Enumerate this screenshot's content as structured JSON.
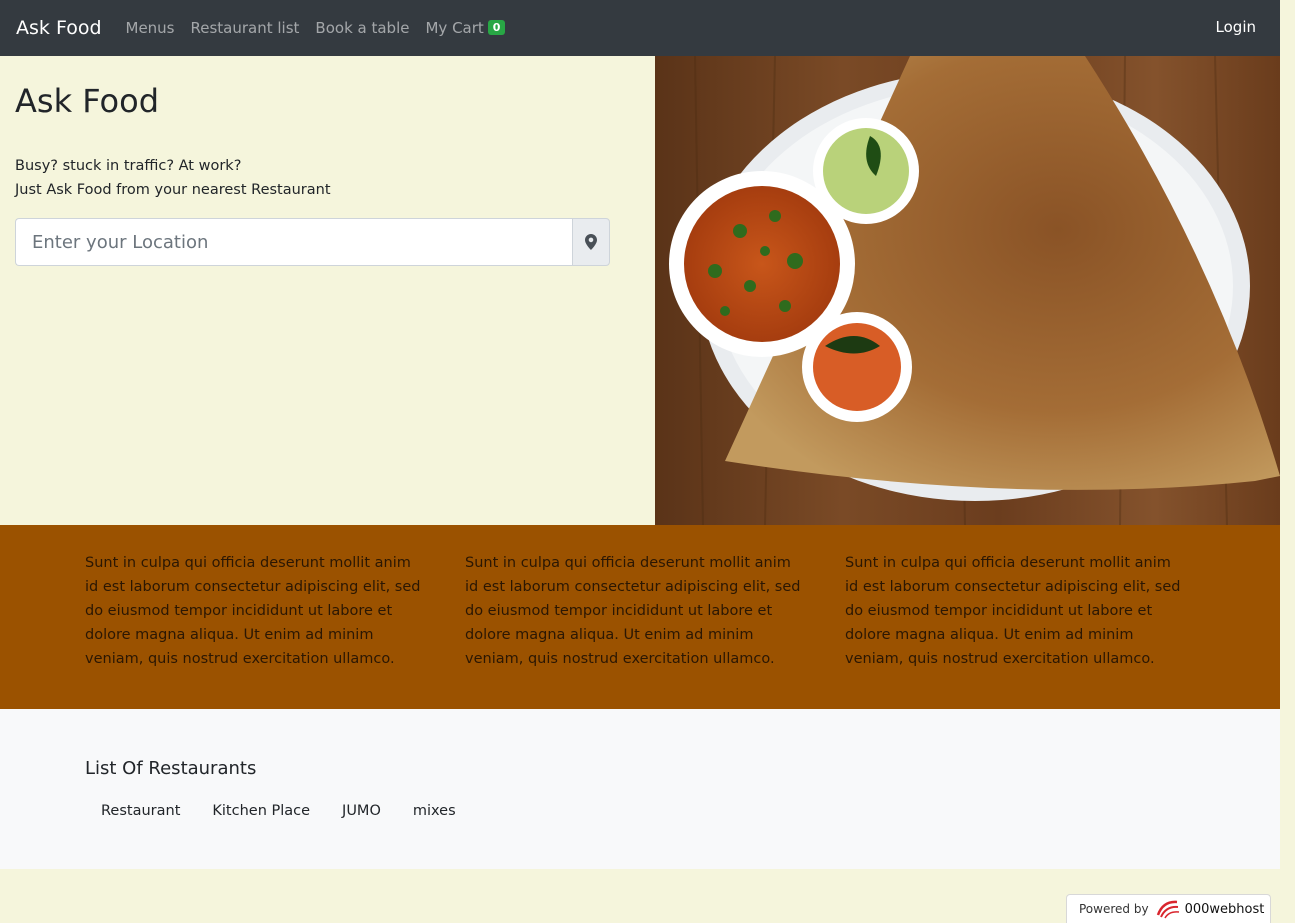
{
  "navbar": {
    "brand": "Ask Food",
    "links": [
      "Menus",
      "Restaurant list",
      "Book a table",
      "My Cart"
    ],
    "cart_count": "0",
    "login": "Login"
  },
  "hero": {
    "title": "Ask Food",
    "line1": "Busy? stuck in traffic? At work?",
    "line2": "Just Ask Food from your nearest Restaurant",
    "location_placeholder": "Enter your Location",
    "location_icon": "map-marker-icon"
  },
  "features": [
    "Sunt in culpa qui officia deserunt mollit anim id est laborum consectetur adipiscing elit, sed do eiusmod tempor incididunt ut labore et dolore magna aliqua. Ut enim ad minim veniam, quis nostrud exercitation ullamco.",
    "Sunt in culpa qui officia deserunt mollit anim id est laborum consectetur adipiscing elit, sed do eiusmod tempor incididunt ut labore et dolore magna aliqua. Ut enim ad minim veniam, quis nostrud exercitation ullamco.",
    "Sunt in culpa qui officia deserunt mollit anim id est laborum consectetur adipiscing elit, sed do eiusmod tempor incididunt ut labore et dolore magna aliqua. Ut enim ad minim veniam, quis nostrud exercitation ullamco."
  ],
  "restaurants": {
    "heading": "List Of Restaurants",
    "items": [
      "Restaurant",
      "Kitchen Place",
      "JUMO",
      "mixes"
    ]
  },
  "powered": {
    "label": "Powered by",
    "brand": "000webhost"
  },
  "colors": {
    "navbar": "#343a40",
    "hero_bg": "#f5f5dc",
    "features_bg": "#9b5200",
    "cart_badge": "#28a745"
  }
}
